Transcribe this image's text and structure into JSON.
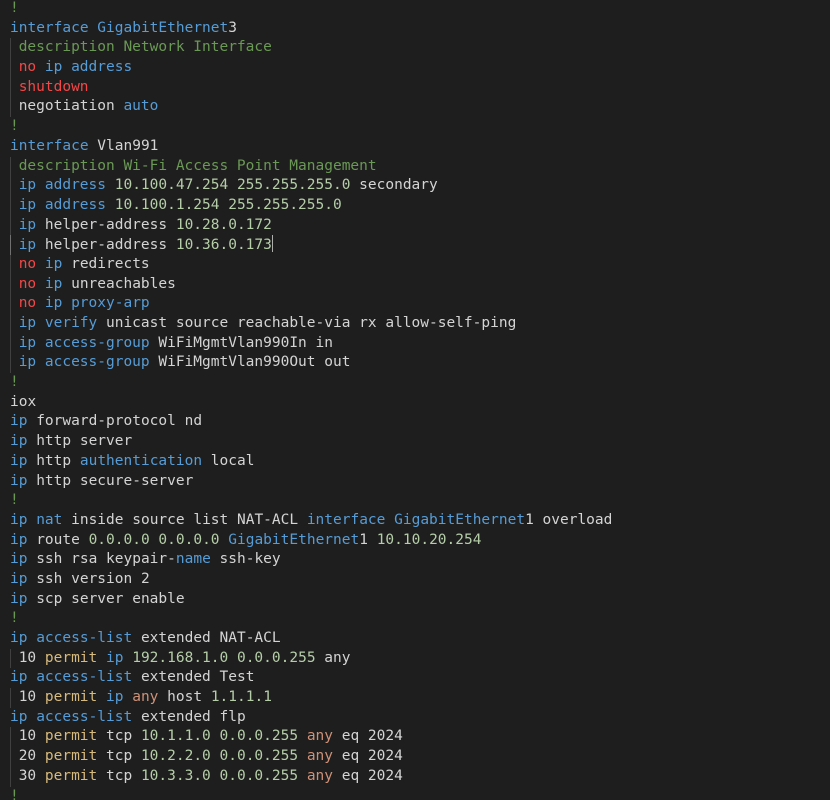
{
  "colors": {
    "background": "#1e1e1e",
    "text": "#d4d4d4",
    "keyword": "#569cd6",
    "string": "#6a9955",
    "negation": "#f44747",
    "number": "#b5cea8",
    "action": "#d7ba7d",
    "any": "#ce9178",
    "separator": "#6a9955"
  },
  "editor": {
    "lines": [
      {
        "indent": false,
        "tokens": [
          [
            "sep",
            "!"
          ]
        ]
      },
      {
        "indent": false,
        "tokens": [
          [
            "kw",
            "interface GigabitEthernet"
          ],
          [
            "txt",
            "3"
          ]
        ]
      },
      {
        "indent": true,
        "tokens": [
          [
            "str",
            "description Network Interface"
          ]
        ]
      },
      {
        "indent": true,
        "tokens": [
          [
            "neg",
            "no"
          ],
          [
            "txt",
            " "
          ],
          [
            "kw",
            "ip address"
          ]
        ]
      },
      {
        "indent": true,
        "tokens": [
          [
            "neg",
            "shutdown"
          ]
        ]
      },
      {
        "indent": true,
        "tokens": [
          [
            "txt",
            "negotiation "
          ],
          [
            "kw",
            "auto"
          ]
        ]
      },
      {
        "indent": false,
        "tokens": [
          [
            "sep",
            "!"
          ]
        ]
      },
      {
        "indent": false,
        "tokens": [
          [
            "kw",
            "interface"
          ],
          [
            "txt",
            " Vlan991"
          ]
        ]
      },
      {
        "indent": true,
        "tokens": [
          [
            "str",
            "description Wi-Fi Access Point Management"
          ]
        ]
      },
      {
        "indent": true,
        "tokens": [
          [
            "kw",
            "ip address"
          ],
          [
            "txt",
            " "
          ],
          [
            "num",
            "10.100.47.254 255.255.255.0"
          ],
          [
            "txt",
            " secondary"
          ]
        ]
      },
      {
        "indent": true,
        "tokens": [
          [
            "kw",
            "ip address"
          ],
          [
            "txt",
            " "
          ],
          [
            "num",
            "10.100.1.254 255.255.255.0"
          ]
        ]
      },
      {
        "indent": true,
        "tokens": [
          [
            "kw",
            "ip"
          ],
          [
            "txt",
            " helper-address "
          ],
          [
            "num",
            "10.28.0.172"
          ]
        ]
      },
      {
        "indent": true,
        "cursor": true,
        "tokens": [
          [
            "kw",
            "ip"
          ],
          [
            "txt",
            " helper-address "
          ],
          [
            "num",
            "10.36.0.173"
          ]
        ]
      },
      {
        "indent": true,
        "tokens": [
          [
            "neg",
            "no"
          ],
          [
            "txt",
            " "
          ],
          [
            "kw",
            "ip"
          ],
          [
            "txt",
            " redirects"
          ]
        ]
      },
      {
        "indent": true,
        "tokens": [
          [
            "neg",
            "no"
          ],
          [
            "txt",
            " "
          ],
          [
            "kw",
            "ip"
          ],
          [
            "txt",
            " unreachables"
          ]
        ]
      },
      {
        "indent": true,
        "tokens": [
          [
            "neg",
            "no"
          ],
          [
            "txt",
            " "
          ],
          [
            "kw",
            "ip proxy-arp"
          ]
        ]
      },
      {
        "indent": true,
        "tokens": [
          [
            "kw",
            "ip verify"
          ],
          [
            "txt",
            " unicast source reachable-via rx allow-self-ping"
          ]
        ]
      },
      {
        "indent": true,
        "tokens": [
          [
            "kw",
            "ip access-group"
          ],
          [
            "txt",
            " WiFiMgmtVlan990In in"
          ]
        ]
      },
      {
        "indent": true,
        "tokens": [
          [
            "kw",
            "ip access-group"
          ],
          [
            "txt",
            " WiFiMgmtVlan990Out out"
          ]
        ]
      },
      {
        "indent": false,
        "tokens": [
          [
            "sep",
            "!"
          ]
        ]
      },
      {
        "indent": false,
        "tokens": [
          [
            "txt",
            "iox"
          ]
        ]
      },
      {
        "indent": false,
        "tokens": [
          [
            "kw",
            "ip"
          ],
          [
            "txt",
            " forward-protocol nd"
          ]
        ]
      },
      {
        "indent": false,
        "tokens": [
          [
            "kw",
            "ip"
          ],
          [
            "txt",
            " http server"
          ]
        ]
      },
      {
        "indent": false,
        "tokens": [
          [
            "kw",
            "ip"
          ],
          [
            "txt",
            " http "
          ],
          [
            "kw",
            "authentication"
          ],
          [
            "txt",
            " local"
          ]
        ]
      },
      {
        "indent": false,
        "tokens": [
          [
            "kw",
            "ip"
          ],
          [
            "txt",
            " http secure-server"
          ]
        ]
      },
      {
        "indent": false,
        "tokens": [
          [
            "sep",
            "!"
          ]
        ]
      },
      {
        "indent": false,
        "tokens": [
          [
            "kw",
            "ip nat"
          ],
          [
            "txt",
            " inside source list NAT-ACL "
          ],
          [
            "kw",
            "interface GigabitEthernet"
          ],
          [
            "txt",
            "1 overload"
          ]
        ]
      },
      {
        "indent": false,
        "tokens": [
          [
            "kw",
            "ip"
          ],
          [
            "txt",
            " route "
          ],
          [
            "num",
            "0.0.0.0 0.0.0.0"
          ],
          [
            "txt",
            " "
          ],
          [
            "kw",
            "GigabitEthernet"
          ],
          [
            "txt",
            "1 "
          ],
          [
            "num",
            "10.10.20.254"
          ]
        ]
      },
      {
        "indent": false,
        "tokens": [
          [
            "kw",
            "ip"
          ],
          [
            "txt",
            " ssh rsa keypair-"
          ],
          [
            "kw",
            "name"
          ],
          [
            "txt",
            " ssh-key"
          ]
        ]
      },
      {
        "indent": false,
        "tokens": [
          [
            "kw",
            "ip"
          ],
          [
            "txt",
            " ssh version 2"
          ]
        ]
      },
      {
        "indent": false,
        "tokens": [
          [
            "kw",
            "ip"
          ],
          [
            "txt",
            " scp server enable"
          ]
        ]
      },
      {
        "indent": false,
        "tokens": [
          [
            "sep",
            "!"
          ]
        ]
      },
      {
        "indent": false,
        "tokens": [
          [
            "kw",
            "ip access-list"
          ],
          [
            "txt",
            " extended NAT-ACL"
          ]
        ]
      },
      {
        "indent": true,
        "tokens": [
          [
            "txt",
            "10 "
          ],
          [
            "act",
            "permit"
          ],
          [
            "txt",
            " "
          ],
          [
            "kw",
            "ip"
          ],
          [
            "txt",
            " "
          ],
          [
            "num",
            "192.168.1.0 0.0.0.255"
          ],
          [
            "txt",
            " any"
          ]
        ]
      },
      {
        "indent": false,
        "tokens": [
          [
            "kw",
            "ip access-list"
          ],
          [
            "txt",
            " extended Test"
          ]
        ]
      },
      {
        "indent": true,
        "tokens": [
          [
            "txt",
            "10 "
          ],
          [
            "act",
            "permit"
          ],
          [
            "txt",
            " "
          ],
          [
            "kw",
            "ip"
          ],
          [
            "txt",
            " "
          ],
          [
            "any",
            "any"
          ],
          [
            "txt",
            " host "
          ],
          [
            "num",
            "1.1.1.1"
          ]
        ]
      },
      {
        "indent": false,
        "tokens": [
          [
            "kw",
            "ip access-list"
          ],
          [
            "txt",
            " extended flp"
          ]
        ]
      },
      {
        "indent": true,
        "tokens": [
          [
            "txt",
            "10 "
          ],
          [
            "act",
            "permit"
          ],
          [
            "txt",
            " tcp "
          ],
          [
            "num",
            "10.1.1.0 0.0.0.255"
          ],
          [
            "txt",
            " "
          ],
          [
            "any",
            "any"
          ],
          [
            "txt",
            " eq 2024"
          ]
        ]
      },
      {
        "indent": true,
        "tokens": [
          [
            "txt",
            "20 "
          ],
          [
            "act",
            "permit"
          ],
          [
            "txt",
            " tcp "
          ],
          [
            "num",
            "10.2.2.0 0.0.0.255"
          ],
          [
            "txt",
            " "
          ],
          [
            "any",
            "any"
          ],
          [
            "txt",
            " eq 2024"
          ]
        ]
      },
      {
        "indent": true,
        "tokens": [
          [
            "txt",
            "30 "
          ],
          [
            "act",
            "permit"
          ],
          [
            "txt",
            " tcp "
          ],
          [
            "num",
            "10.3.3.0 0.0.0.255"
          ],
          [
            "txt",
            " "
          ],
          [
            "any",
            "any"
          ],
          [
            "txt",
            " eq 2024"
          ]
        ]
      },
      {
        "indent": false,
        "tokens": [
          [
            "sep",
            "!"
          ]
        ]
      }
    ]
  }
}
